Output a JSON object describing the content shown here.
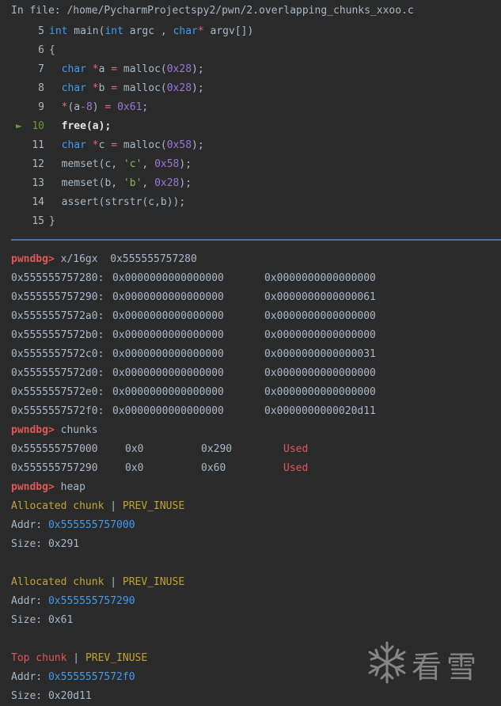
{
  "header": {
    "file_label": "In file: /home/PycharmProjectspy2/pwn/2.overlapping_chunks_xxoo.c"
  },
  "code": {
    "lines": [
      {
        "no": "5",
        "current": false
      },
      {
        "no": "6",
        "current": false
      },
      {
        "no": "7",
        "current": false
      },
      {
        "no": "8",
        "current": false
      },
      {
        "no": "9",
        "current": false
      },
      {
        "no": "10",
        "current": true,
        "marker": "►"
      },
      {
        "no": "11",
        "current": false
      },
      {
        "no": "12",
        "current": false
      },
      {
        "no": "13",
        "current": false
      },
      {
        "no": "14",
        "current": false
      },
      {
        "no": "15",
        "current": false
      }
    ],
    "l5": {
      "t1": "int",
      "t2": " main(",
      "t3": "int",
      "t4": " argc , ",
      "t5": "char",
      "t6": "*",
      "t7": " argv[])"
    },
    "l6": {
      "t1": "{"
    },
    "l7": {
      "t1": "char",
      "t2": " ",
      "t3": "*",
      "t4": "a ",
      "t5": "=",
      "t6": " malloc(",
      "t7": "0x28",
      "t8": ");"
    },
    "l8": {
      "t1": "char",
      "t2": " ",
      "t3": "*",
      "t4": "b ",
      "t5": "=",
      "t6": " malloc(",
      "t7": "0x28",
      "t8": ");"
    },
    "l9": {
      "t1": "*",
      "t2": "(a",
      "t3": "-8",
      "t4": ") ",
      "t5": "=",
      "t6": " ",
      "t7": "0x61",
      "t8": ";"
    },
    "l10": {
      "t1": "free(a);"
    },
    "l11": {
      "t1": "char",
      "t2": " ",
      "t3": "*",
      "t4": "c ",
      "t5": "=",
      "t6": " malloc(",
      "t7": "0x58",
      "t8": ");"
    },
    "l12": {
      "t1": "memset(c, ",
      "t2": "'c'",
      "t3": ", ",
      "t4": "0x58",
      "t5": ");"
    },
    "l13": {
      "t1": "memset(b, ",
      "t2": "'b'",
      "t3": ", ",
      "t4": "0x28",
      "t5": ");"
    },
    "l14": {
      "t1": "assert(strstr(c,b));"
    },
    "l15": {
      "t1": "}"
    }
  },
  "terminal": {
    "prompt": "pwndbg>",
    "cmd1": " x/16gx  0x555555757280",
    "memory": [
      {
        "addr": "0x555555757280:",
        "v1": "0x0000000000000000",
        "v2": "0x0000000000000000"
      },
      {
        "addr": "0x555555757290:",
        "v1": "0x0000000000000000",
        "v2": "0x0000000000000061"
      },
      {
        "addr": "0x5555557572a0:",
        "v1": "0x0000000000000000",
        "v2": "0x0000000000000000"
      },
      {
        "addr": "0x5555557572b0:",
        "v1": "0x0000000000000000",
        "v2": "0x0000000000000000"
      },
      {
        "addr": "0x5555557572c0:",
        "v1": "0x0000000000000000",
        "v2": "0x0000000000000031"
      },
      {
        "addr": "0x5555557572d0:",
        "v1": "0x0000000000000000",
        "v2": "0x0000000000000000"
      },
      {
        "addr": "0x5555557572e0:",
        "v1": "0x0000000000000000",
        "v2": "0x0000000000000000"
      },
      {
        "addr": "0x5555557572f0:",
        "v1": "0x0000000000000000",
        "v2": "0x0000000000020d11"
      }
    ],
    "cmd2": " chunks",
    "chunks": [
      {
        "addr": "0x555555757000",
        "prev": "0x0",
        "size": "0x290",
        "status": "Used"
      },
      {
        "addr": "0x555555757290",
        "prev": "0x0",
        "size": "0x60",
        "status": "Used"
      }
    ],
    "cmd3": " heap",
    "heap": [
      {
        "title": "Allocated chunk",
        "flag": "PREV_INUSE",
        "addr_label": "Addr: ",
        "addr": "0x555555757000",
        "size_label": "Size: ",
        "size": "0x291"
      },
      {
        "title": "Allocated chunk",
        "flag": "PREV_INUSE",
        "addr_label": "Addr: ",
        "addr": "0x555555757290",
        "size_label": "Size: ",
        "size": "0x61"
      },
      {
        "title": "Top chunk",
        "flag": "PREV_INUSE",
        "addr_label": "Addr: ",
        "addr": "0x5555557572f0",
        "size_label": "Size: ",
        "size": "0x20d11"
      }
    ],
    "sep": " | "
  },
  "watermark": {
    "text": "看雪",
    "icon": "snowflake-icon"
  },
  "colors": {
    "background": "#2b2b2b",
    "keyword": "#3d9bf6",
    "number": "#9876d6",
    "string": "#87b94c",
    "prompt": "#e05555",
    "used": "#e05555",
    "flag_yellow": "#c2a134",
    "addr_blue": "#3d9bf6",
    "separator": "#3a79c4"
  }
}
